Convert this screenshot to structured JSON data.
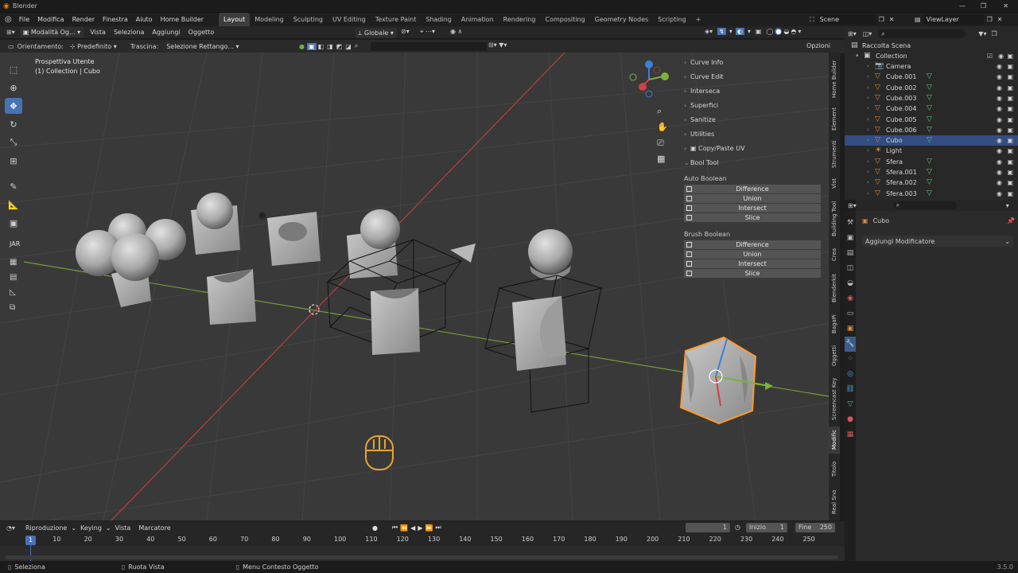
{
  "title": "Blender",
  "menu": [
    "File",
    "Modifica",
    "Render",
    "Finestra",
    "Aiuto",
    "Home Builder"
  ],
  "workspaces": [
    "Layout",
    "Modeling",
    "Sculpting",
    "UV Editing",
    "Texture Paint",
    "Shading",
    "Animation",
    "Rendering",
    "Compositing",
    "Geometry Nodes",
    "Scripting"
  ],
  "active_workspace": "Layout",
  "add_tab": "+",
  "scene": "Scene",
  "view_layer": "ViewLayer",
  "vp_header": {
    "mode": "Modalità Og...",
    "menus": [
      "Vista",
      "Seleziona",
      "Aggiungi",
      "Oggetto"
    ],
    "transform": "Globale"
  },
  "vp_header2": {
    "orient_label": "Orientamento:",
    "orient_value": "Predefinito",
    "drag_label": "Trascina:",
    "drag_value": "Selezione Rettango...",
    "options": "Opzioni"
  },
  "viewport": {
    "view_name": "Prospettiva Utente",
    "collection": "(1) Collection | Cubo",
    "side_label": "JAR"
  },
  "npanel": {
    "sections": [
      "Curve Info",
      "Curve Edit",
      "Interseca",
      "Superfici",
      "Sanitize",
      "Utilities",
      "Copy/Paste UV",
      "Bool Tool"
    ],
    "auto_label": "Auto Boolean",
    "auto_buttons": [
      "Difference",
      "Union",
      "Intersect",
      "Slice"
    ],
    "brush_label": "Brush Boolean",
    "brush_buttons": [
      "Difference",
      "Union",
      "Intersect",
      "Slice"
    ]
  },
  "side_tabs": [
    "Home Builder",
    "Element",
    "Strumenti",
    "Vist",
    "Building Tool",
    "Crea",
    "Blenderkit",
    "BagaPi",
    "Oggetti",
    "Screencast Key",
    "Modific",
    "Titolo",
    "Real Sno"
  ],
  "outliner": {
    "root": "Raccolta Scena",
    "collection": "Collection",
    "items": [
      {
        "name": "Camera",
        "type": "camera"
      },
      {
        "name": "Cube.001",
        "type": "mesh"
      },
      {
        "name": "Cube.002",
        "type": "mesh"
      },
      {
        "name": "Cube.003",
        "type": "mesh"
      },
      {
        "name": "Cube.004",
        "type": "mesh"
      },
      {
        "name": "Cube.005",
        "type": "mesh"
      },
      {
        "name": "Cube.006",
        "type": "mesh"
      },
      {
        "name": "Cubo",
        "type": "mesh",
        "selected": true
      },
      {
        "name": "Light",
        "type": "light"
      },
      {
        "name": "Sfera",
        "type": "mesh"
      },
      {
        "name": "Sfera.001",
        "type": "mesh"
      },
      {
        "name": "Sfera.002",
        "type": "mesh"
      },
      {
        "name": "Sfera.003",
        "type": "mesh"
      }
    ]
  },
  "properties": {
    "object": "Cubo",
    "add_modifier": "Aggiungi Modificatore"
  },
  "timeline": {
    "menus": [
      "Riproduzione",
      "Keying",
      "Vista",
      "Marcatore"
    ],
    "current_frame": "1",
    "start_label": "Inizio",
    "start": "1",
    "end_label": "Fine",
    "end": "250",
    "ticks": [
      "10",
      "20",
      "30",
      "40",
      "50",
      "60",
      "70",
      "80",
      "90",
      "100",
      "110",
      "120",
      "130",
      "140",
      "150",
      "160",
      "170",
      "180",
      "190",
      "200",
      "210",
      "220",
      "230",
      "240",
      "250"
    ],
    "playhead": "1"
  },
  "status": {
    "select": "Seleziona",
    "rotate": "Ruota Vista",
    "context": "Menu Contesto Oggetto",
    "version": "3.5.0"
  },
  "colors": {
    "accent": "#4772b3",
    "selected_outline": "#ff9a2e",
    "x_axis": "#d24040",
    "y_axis": "#7ab23c",
    "z_axis": "#3b80d8"
  }
}
